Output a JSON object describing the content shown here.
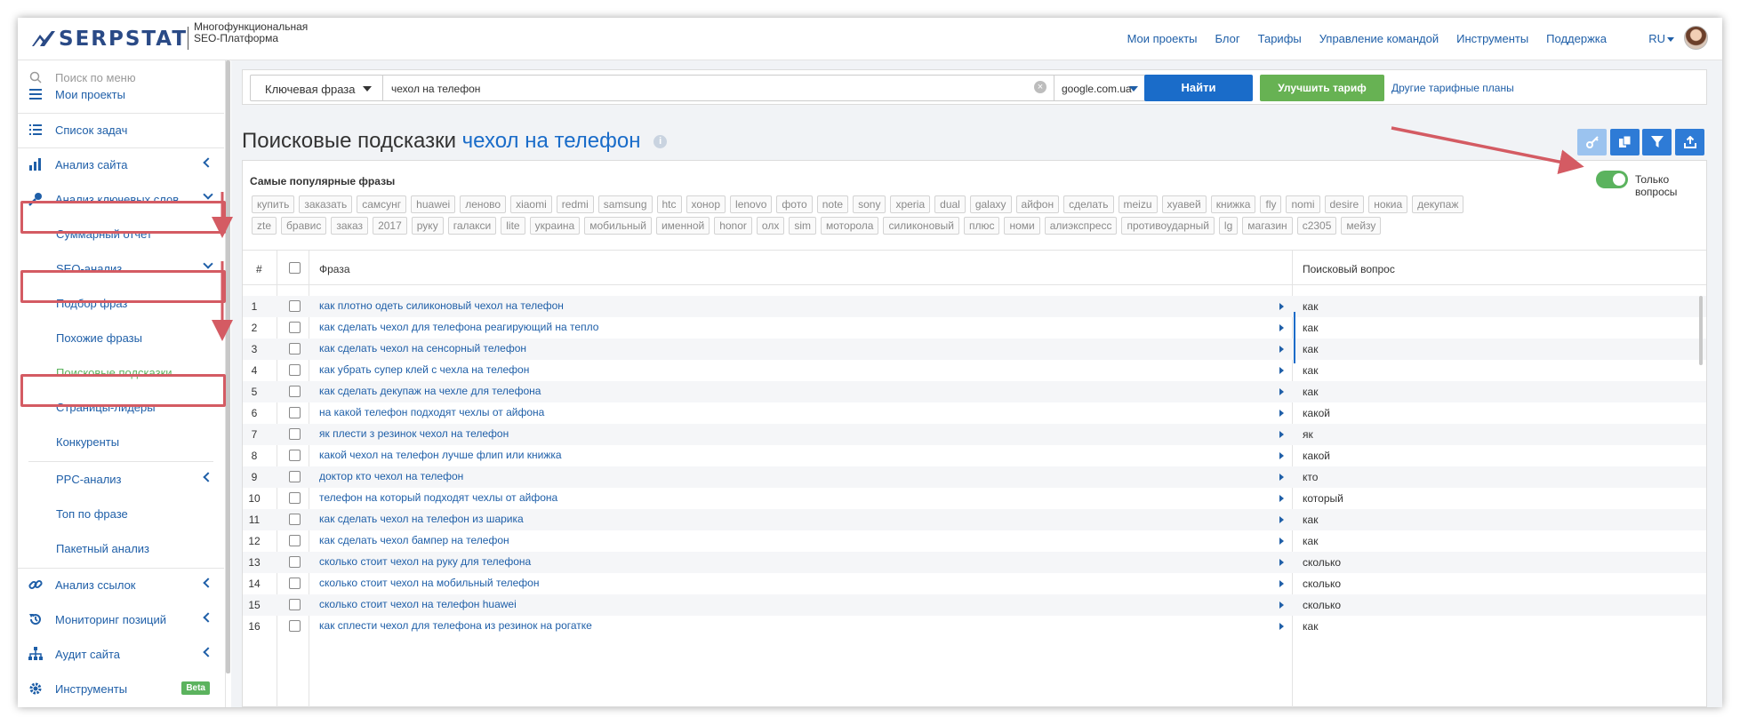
{
  "header": {
    "logo_text": "SERPSTAT",
    "tagline_line1": "Многофункциональная",
    "tagline_line2": "SEO-Платформа",
    "nav": [
      "Мои проекты",
      "Блог",
      "Тарифы",
      "Управление командой",
      "Инструменты",
      "Поддержка"
    ],
    "lang": "RU"
  },
  "sidebar": {
    "search_placeholder": "Поиск по меню",
    "my_projects": "Мои проекты",
    "tasks": "Список задач",
    "site_analysis": "Анализ сайта",
    "keyword_analysis": "Анализ ключевых слов",
    "summary": "Суммарный отчет",
    "seo_analysis": "SEO-анализ",
    "phrase_selection": "Подбор фраз",
    "similar_phrases": "Похожие фразы",
    "search_suggestions": "Поисковые подсказки",
    "leader_pages": "Страницы-лидеры",
    "competitors": "Конкуренты",
    "ppc_analysis": "PPC-анализ",
    "top_by_phrase": "Топ по фразе",
    "batch_analysis": "Пакетный анализ",
    "link_analysis": "Анализ ссылок",
    "rank_monitoring": "Мониторинг позиций",
    "site_audit": "Аудит сайта",
    "tools": "Инструменты",
    "beta": "Beta"
  },
  "search": {
    "type": "Ключевая фраза",
    "query": "чехол на телефон",
    "region": "google.com.ua",
    "find_button": "Найти",
    "upgrade_button": "Улучшить тариф",
    "other_plans": "Другие тарифные планы"
  },
  "page": {
    "title": "Поисковые подсказки",
    "query": "чехол на телефон",
    "popular_title": "Самые популярные фразы",
    "toggle_label": "Только вопросы",
    "toggle_on": true
  },
  "tags": [
    "купить",
    "заказать",
    "самсунг",
    "huawei",
    "леново",
    "xiaomi",
    "redmi",
    "samsung",
    "htc",
    "хонор",
    "lenovo",
    "фото",
    "note",
    "sony",
    "xperia",
    "dual",
    "galaxy",
    "айфон",
    "сделать",
    "meizu",
    "хуавей",
    "книжка",
    "fly",
    "nomi",
    "desire",
    "нокиа",
    "декупаж",
    "zte",
    "бравис",
    "заказ",
    "2017",
    "руку",
    "галакси",
    "lite",
    "украина",
    "мобильный",
    "именной",
    "honor",
    "олх",
    "sim",
    "моторола",
    "силиконовый",
    "плюс",
    "номи",
    "алиэкспресс",
    "противоударный",
    "lg",
    "магазин",
    "c2305",
    "мейзу"
  ],
  "table": {
    "headers": {
      "num": "#",
      "phrase": "Фраза",
      "question": "Поисковый вопрос"
    },
    "rows": [
      {
        "n": "1",
        "phrase": "как плотно одеть силиконовый чехол на телефон",
        "q": "как"
      },
      {
        "n": "2",
        "phrase": "как сделать чехол для телефона реагирующий на тепло",
        "q": "как"
      },
      {
        "n": "3",
        "phrase": "как сделать чехол на сенсорный телефон",
        "q": "как"
      },
      {
        "n": "4",
        "phrase": "как убрать супер клей с чехла на телефон",
        "q": "как"
      },
      {
        "n": "5",
        "phrase": "как сделать декупаж на чехле для телефона",
        "q": "как"
      },
      {
        "n": "6",
        "phrase": "на какой телефон подходят чехлы от айфона",
        "q": "какой"
      },
      {
        "n": "7",
        "phrase": "як плести з резинок чехол на телефон",
        "q": "як"
      },
      {
        "n": "8",
        "phrase": "какой чехол на телефон лучше флип или книжка",
        "q": "какой"
      },
      {
        "n": "9",
        "phrase": "доктор кто чехол на телефон",
        "q": "кто"
      },
      {
        "n": "10",
        "phrase": "телефон на который подходят чехлы от айфона",
        "q": "который"
      },
      {
        "n": "11",
        "phrase": "как сделать чехол на телефон из шарика",
        "q": "как"
      },
      {
        "n": "12",
        "phrase": "как сделать чехол бампер на телефон",
        "q": "как"
      },
      {
        "n": "13",
        "phrase": "сколько стоит чехол на руку для телефона",
        "q": "сколько"
      },
      {
        "n": "14",
        "phrase": "сколько стоит чехол на мобильный телефон",
        "q": "сколько"
      },
      {
        "n": "15",
        "phrase": "сколько стоит чехол на телефон huawei",
        "q": "сколько"
      },
      {
        "n": "16",
        "phrase": "как сплести чехол для телефона из резинок на рогатке",
        "q": "как"
      }
    ]
  },
  "colors": {
    "brand": "#2a4a86",
    "link": "#1f5fa8",
    "primary_button": "#1a6cc9",
    "upgrade_button": "#67b253",
    "highlight": "#d45b63"
  }
}
